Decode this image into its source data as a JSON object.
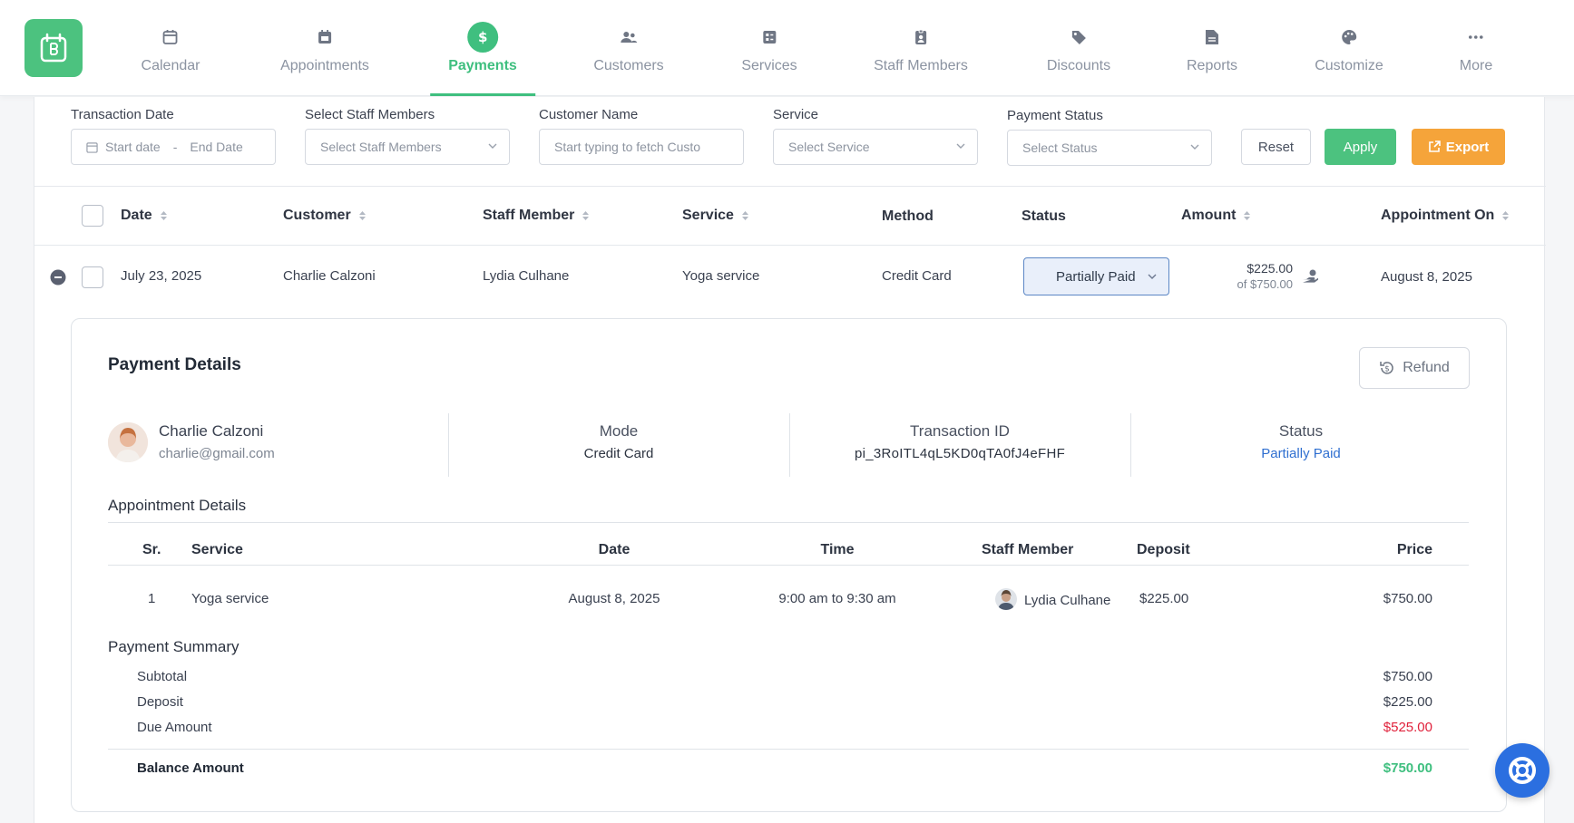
{
  "nav": {
    "items": [
      {
        "label": "Calendar",
        "icon": "calendar-icon"
      },
      {
        "label": "Appointments",
        "icon": "appointment-icon"
      },
      {
        "label": "Payments",
        "icon": "dollar-icon",
        "active": true
      },
      {
        "label": "Customers",
        "icon": "users-icon"
      },
      {
        "label": "Services",
        "icon": "services-icon"
      },
      {
        "label": "Staff Members",
        "icon": "staff-badge-icon"
      },
      {
        "label": "Discounts",
        "icon": "tag-icon"
      },
      {
        "label": "Reports",
        "icon": "report-icon"
      },
      {
        "label": "Customize",
        "icon": "palette-icon"
      },
      {
        "label": "More",
        "icon": "more-dots-icon"
      }
    ]
  },
  "filters": {
    "transaction_date": {
      "label": "Transaction Date",
      "start_placeholder": "Start date",
      "separator": "-",
      "end_placeholder": "End Date"
    },
    "staff": {
      "label": "Select Staff Members",
      "placeholder": "Select Staff Members"
    },
    "customer": {
      "label": "Customer Name",
      "placeholder": "Start typing to fetch Custo"
    },
    "service": {
      "label": "Service",
      "placeholder": "Select Service"
    },
    "status": {
      "label": "Payment Status",
      "placeholder": "Select Status"
    },
    "reset_label": "Reset",
    "apply_label": "Apply",
    "export_label": "Export"
  },
  "table": {
    "columns": [
      "Date",
      "Customer",
      "Staff Member",
      "Service",
      "Method",
      "Status",
      "Amount",
      "Appointment On"
    ],
    "row": {
      "date": "July 23, 2025",
      "customer": "Charlie Calzoni",
      "staff": "Lydia Culhane",
      "service": "Yoga service",
      "method": "Credit Card",
      "status": "Partially Paid",
      "amount": "$225.00",
      "amount_total": "of $750.00",
      "appointment_on": "August 8, 2025"
    }
  },
  "details": {
    "title": "Payment Details",
    "refund_label": "Refund",
    "customer_name": "Charlie Calzoni",
    "customer_email": "charlie@gmail.com",
    "mode_label": "Mode",
    "mode_value": "Credit Card",
    "txn_label": "Transaction ID",
    "txn_value": "pi_3RoITL4qL5KD0qTA0fJ4eFHF",
    "status_label": "Status",
    "status_value": "Partially Paid",
    "appointment_title": "Appointment Details",
    "appt_columns": [
      "Sr.",
      "Service",
      "Date",
      "Time",
      "Staff Member",
      "Deposit",
      "Price"
    ],
    "appt_row": {
      "sr": "1",
      "service": "Yoga service",
      "date": "August 8, 2025",
      "time": "9:00 am to 9:30 am",
      "staff": "Lydia Culhane",
      "deposit": "$225.00",
      "price": "$750.00"
    },
    "summary_title": "Payment Summary",
    "summary": [
      {
        "label": "Subtotal",
        "value": "$750.00"
      },
      {
        "label": "Deposit",
        "value": "$225.00"
      },
      {
        "label": "Due Amount",
        "value": "$525.00"
      }
    ],
    "balance_label": "Balance Amount",
    "balance_value": "$750.00"
  },
  "colors": {
    "accent": "#3fbf7f",
    "link": "#2f6fd0",
    "due": "#e0213b",
    "export": "#f5a43a"
  }
}
